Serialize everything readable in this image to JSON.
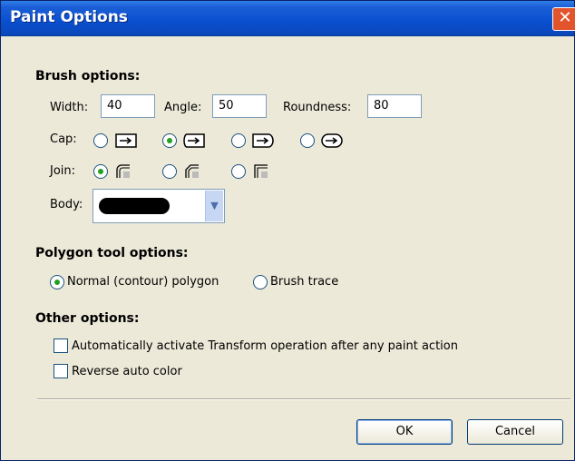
{
  "window": {
    "title": "Paint Options",
    "close_label": "✕"
  },
  "brush": {
    "heading": "Brush options:",
    "width_label": "Width:",
    "width_value": "40",
    "angle_label": "Angle:",
    "angle_value": "50",
    "roundness_label": "Roundness:",
    "roundness_value": "80",
    "cap_label": "Cap:",
    "cap_options": [
      {
        "icon": "cap-flat-icon",
        "selected": false
      },
      {
        "icon": "cap-round-icon",
        "selected": true
      },
      {
        "icon": "cap-square-icon",
        "selected": false
      },
      {
        "icon": "cap-pill-icon",
        "selected": false
      }
    ],
    "join_label": "Join:",
    "join_options": [
      {
        "icon": "join-round-icon",
        "selected": true
      },
      {
        "icon": "join-bevel-icon",
        "selected": false
      },
      {
        "icon": "join-miter-icon",
        "selected": false
      }
    ],
    "body_label": "Body:"
  },
  "polygon": {
    "heading": "Polygon tool options:",
    "normal_label": "Normal (contour) polygon",
    "normal_selected": true,
    "brush_trace_label": "Brush trace",
    "brush_trace_selected": false
  },
  "other": {
    "heading": "Other options:",
    "auto_transform_label": "Automatically activate Transform operation after any paint action",
    "auto_transform_checked": false,
    "reverse_color_label": "Reverse auto color",
    "reverse_color_checked": false
  },
  "buttons": {
    "ok_label": "OK",
    "cancel_label": "Cancel"
  }
}
